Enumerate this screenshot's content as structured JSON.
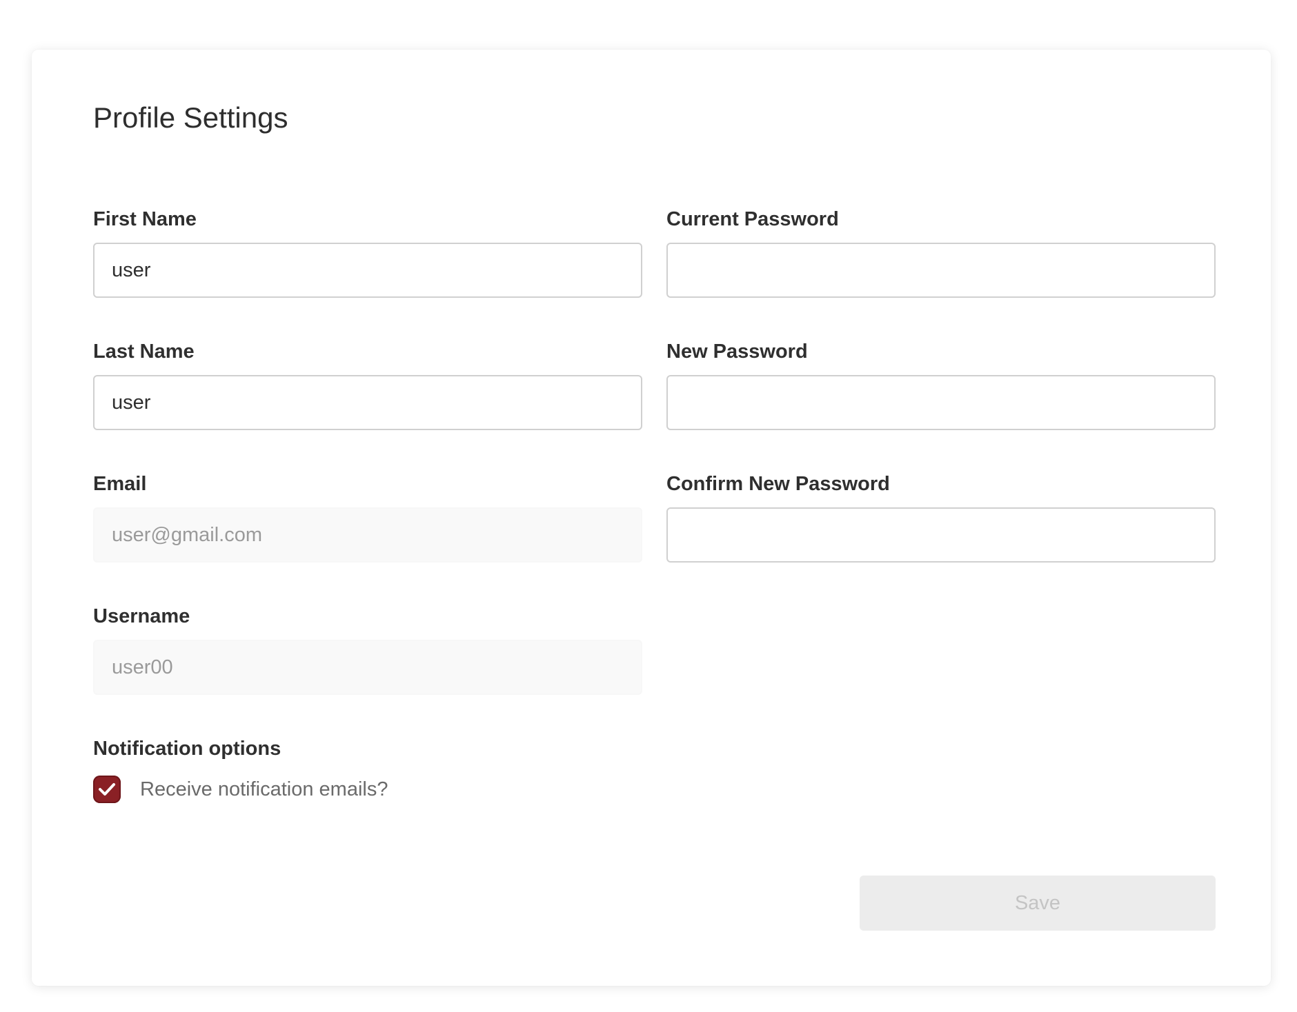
{
  "page": {
    "title": "Profile Settings"
  },
  "form": {
    "first_name": {
      "label": "First Name",
      "value": "user"
    },
    "last_name": {
      "label": "Last Name",
      "value": "user"
    },
    "email": {
      "label": "Email",
      "value": "user@gmail.com"
    },
    "username": {
      "label": "Username",
      "value": "user00"
    },
    "current_password": {
      "label": "Current Password",
      "value": ""
    },
    "new_password": {
      "label": "New Password",
      "value": ""
    },
    "confirm_new_password": {
      "label": "Confirm New Password",
      "value": ""
    }
  },
  "notifications": {
    "label": "Notification options",
    "checkbox_label": "Receive notification emails?",
    "checked": true
  },
  "actions": {
    "save_label": "Save"
  },
  "colors": {
    "accent": "#8a2025",
    "disabled_bg": "#ececec",
    "disabled_text": "#c4c4c4"
  }
}
